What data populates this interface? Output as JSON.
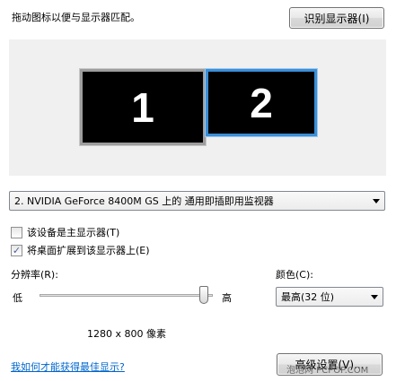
{
  "instruction": "拖动图标以便与显示器匹配。",
  "identify_button": "识别显示器(I)",
  "monitors": [
    {
      "number": "1"
    },
    {
      "number": "2"
    }
  ],
  "display_select": {
    "value": "2. NVIDIA GeForce 8400M GS 上的 通用即插即用监视器"
  },
  "checkboxes": [
    {
      "label": "该设备是主显示器(T)",
      "checked": false
    },
    {
      "label": "将桌面扩展到该显示器上(E)",
      "checked": true
    }
  ],
  "resolution": {
    "label": "分辨率(R):",
    "low": "低",
    "high": "高",
    "value": "1280 x 800 像素",
    "slider_level": 1.0
  },
  "color": {
    "label": "颜色(C):",
    "value": "最高(32 位)"
  },
  "help_link": "我如何才能获得最佳显示?",
  "advanced_button": "高级设置(V)...",
  "watermark": "泡泡网 PCPOP.COM"
}
